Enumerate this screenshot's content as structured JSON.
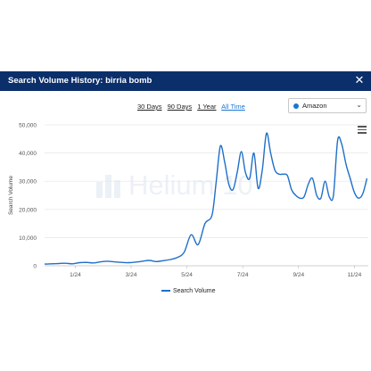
{
  "modal": {
    "title": "Search Volume History: birria bomb",
    "close_icon": "close-icon",
    "range_options": [
      {
        "label": "30 Days",
        "active": false
      },
      {
        "label": "90 Days",
        "active": false
      },
      {
        "label": "1 Year",
        "active": false
      },
      {
        "label": "All Time",
        "active": true
      }
    ],
    "market": {
      "label": "Amazon",
      "dot_color": "#1976d2",
      "chevron_icon": "chevron-down-icon"
    },
    "menu_icon": "hamburger-menu-icon",
    "watermark": "Helium 10"
  },
  "colors": {
    "title_bar": "#0b2f6b",
    "series": "#1f6fc9",
    "active_link": "#1976d2"
  },
  "chart_data": {
    "type": "line",
    "ylabel": "Search Volume",
    "xlabel": "",
    "ylim": [
      0,
      50000
    ],
    "yticks": [
      "0",
      "10,000",
      "20,000",
      "30,000",
      "40,000",
      "50,000"
    ],
    "xticks": [
      "1/24",
      "3/24",
      "5/24",
      "7/24",
      "9/24",
      "11/24"
    ],
    "x_range_months": [
      0,
      23.2
    ],
    "grid": true,
    "legend": "bottom-center",
    "series": [
      {
        "name": "Search Volume",
        "x": [
          0,
          0.5,
          1,
          1.5,
          2,
          2.5,
          3,
          3.5,
          4,
          4.5,
          5,
          5.5,
          6,
          6.5,
          7,
          7.5,
          8,
          8.5,
          9,
          9.5,
          10,
          10.5,
          11,
          11.5,
          12,
          12.3,
          12.6,
          12.9,
          13.2,
          13.5,
          13.8,
          14.1,
          14.4,
          14.7,
          15.0,
          15.3,
          15.6,
          15.9,
          16.2,
          16.5,
          16.8,
          17.1,
          17.4,
          17.7,
          18.0,
          18.3,
          18.6,
          18.9,
          19.2,
          19.5,
          19.8,
          20.1,
          20.4,
          20.7,
          21.0,
          21.3,
          21.6,
          21.9,
          22.2,
          22.5,
          22.8,
          23.1
        ],
        "y": [
          600,
          700,
          800,
          900,
          700,
          1100,
          1200,
          1000,
          1400,
          1600,
          1400,
          1200,
          1100,
          1300,
          1600,
          1900,
          1500,
          1800,
          2200,
          2900,
          4800,
          11000,
          7500,
          15000,
          18000,
          30000,
          42500,
          37000,
          29000,
          27000,
          33000,
          40500,
          33000,
          31000,
          40000,
          27500,
          34000,
          47000,
          40000,
          34000,
          32500,
          32500,
          32000,
          27000,
          25000,
          24000,
          24500,
          29000,
          31000,
          25000,
          24000,
          30000,
          24500,
          25000,
          44500,
          43000,
          36000,
          31000,
          26000,
          24000,
          25500,
          31000
        ]
      }
    ]
  }
}
